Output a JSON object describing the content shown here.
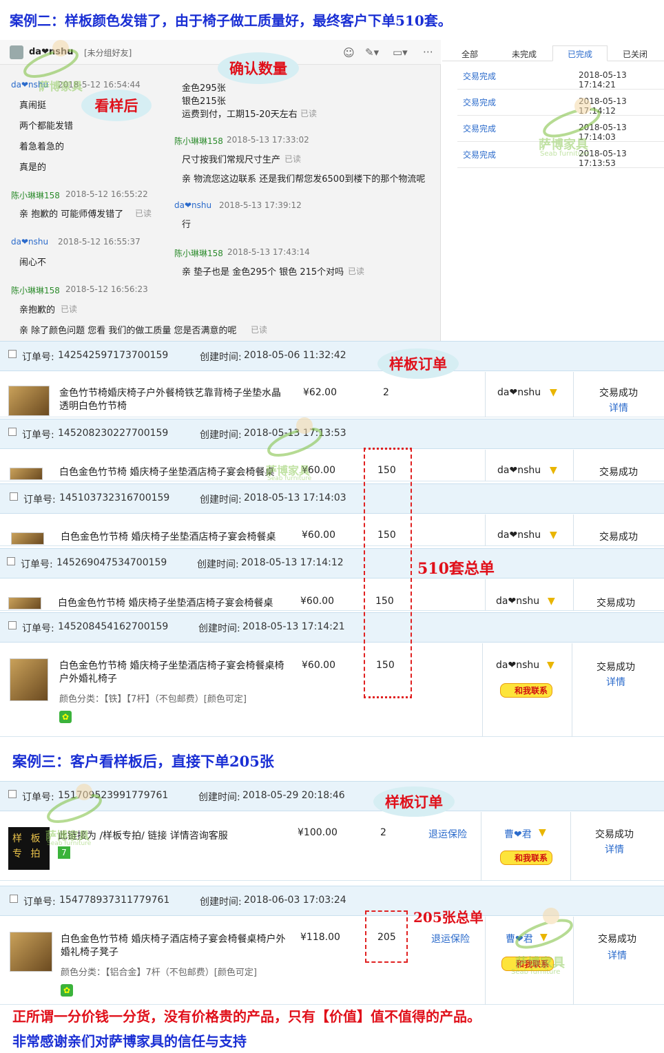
{
  "case2_title": "案例二：样板颜色发错了，由于椅子做工质量好，最终客户下单510套。",
  "chat": {
    "contact_name": "da❤nshu",
    "group_label": "[未分组好友]",
    "bubbles": {
      "confirm_qty": "确认数量",
      "after_sample": "看样后"
    },
    "messages": [
      {
        "sender": "da❤nshu",
        "time": "2018-5-12 16:54:44",
        "lines": [
          "真闹挺",
          "两个都能发错",
          "着急着急的",
          "真是的"
        ]
      },
      {
        "sender": "陈小琳琳158",
        "time": "2018-5-12 16:55:22",
        "lines": [
          "亲 抱歉的  可能师傅发错了"
        ],
        "read": "已读"
      },
      {
        "sender": "da❤nshu",
        "time": "2018-5-12 16:55:37",
        "lines": [
          "闹心不"
        ]
      },
      {
        "sender": "陈小琳琳158",
        "time": "2018-5-12 16:56:23",
        "lines": [
          "亲抱歉的",
          "亲 除了颜色问题 您看 我们的做工质量 您是否满意的呢"
        ],
        "read": "已读"
      },
      {
        "sender": "",
        "time": "",
        "lines": [
          "金色295张",
          "银色215张",
          "运费到付，工期15-20天左右"
        ],
        "read": "已读"
      },
      {
        "sender": "陈小琳琳158",
        "time": "2018-5-13 17:33:02",
        "lines": [
          "尺寸按我们常规尺寸生产",
          "亲 物流您这边联系 还是我们帮您发6500到楼下的那个物流呢"
        ],
        "read": "已读"
      },
      {
        "sender": "da❤nshu",
        "time": "2018-5-13 17:39:12",
        "lines": [
          "行"
        ]
      },
      {
        "sender": "陈小琳琳158",
        "time": "2018-5-13 17:43:14",
        "lines": [
          "亲 垫子也是 金色295个  银色 215个对吗"
        ],
        "read": "已读"
      }
    ]
  },
  "tabs": [
    "全部",
    "未完成",
    "已完成",
    "已关闭"
  ],
  "trade_rows": [
    {
      "status": "交易完成",
      "time": "2018-05-13 17:14:21"
    },
    {
      "status": "交易完成",
      "time": "2018-05-13 17:14:12"
    },
    {
      "status": "交易完成",
      "time": "2018-05-13 17:14:03"
    },
    {
      "status": "交易完成",
      "time": "2018-05-13 17:13:53"
    }
  ],
  "labels": {
    "order_no": "订单号:",
    "created": "创建时间:",
    "sample_order": "样板订单",
    "total_510": "510套总单",
    "total_205": "205张总单",
    "trade_success": "交易成功",
    "details": "详情",
    "contact_me": "和我联系",
    "return_insurance": "退运保险",
    "buyer": "da❤nshu",
    "buyer2": "曹❤君"
  },
  "orders": [
    {
      "no": "142542597173700159",
      "created": "2018-05-06 11:32:42",
      "title": "金色竹节椅婚庆椅子户外餐椅铁艺靠背椅子坐垫水晶透明白色竹节椅",
      "price": "¥62.00",
      "qty": "2"
    },
    {
      "no": "145208230227700159",
      "created": "2018-05-13 17:13:53",
      "title": "白色金色竹节椅 婚庆椅子坐垫酒店椅子宴会椅餐桌",
      "price": "¥60.00",
      "qty": "150"
    },
    {
      "no": "145103732316700159",
      "created": "2018-05-13 17:14:03",
      "title": "白色金色竹节椅 婚庆椅子坐垫酒店椅子宴会椅餐桌",
      "price": "¥60.00",
      "qty": "150"
    },
    {
      "no": "145269047534700159",
      "created": "2018-05-13 17:14:12",
      "title": "白色金色竹节椅 婚庆椅子坐垫酒店椅子宴会椅餐桌",
      "price": "¥60.00",
      "qty": "150"
    },
    {
      "no": "145208454162700159",
      "created": "2018-05-13 17:14:21",
      "title": "白色金色竹节椅 婚庆椅子坐垫酒店椅子宴会椅餐桌椅户外婚礼椅子",
      "price": "¥60.00",
      "qty": "150",
      "spec": "颜色分类：【铁】【7杆】（不包邮费）[颜色可定]"
    }
  ],
  "case3_title": "案例三：客户看样板后，直接下单205张",
  "orders3": [
    {
      "no": "151709523991779761",
      "created": "2018-05-29 20:18:46",
      "title": "此链接为 /样板专拍/ 链接 详情咨询客服",
      "price": "¥100.00",
      "qty": "2",
      "thumb_text": "样 板 专 拍"
    },
    {
      "no": "154778937311779761",
      "created": "2018-06-03 17:03:24",
      "title": "白色金色竹节椅 婚庆椅子酒店椅子宴会椅餐桌椅户外婚礼椅子凳子",
      "price": "¥118.00",
      "qty": "205",
      "spec": "颜色分类：【铝合金】7杆（不包邮费）[颜色可定]"
    }
  ],
  "footer": {
    "line1": "正所谓一分价钱一分货，没有价格贵的产品，只有【价值】值不值得的产品。",
    "line2": "非常感谢亲们对萨博家具的信任与支持"
  },
  "watermark": {
    "cn": "萨博家具",
    "en": "Seab furniture"
  },
  "colors": {
    "heading_blue": "#1a2fd4",
    "accent_red": "#e0101a",
    "link_blue": "#2a6acb",
    "order_header_bg": "#e8f3fa"
  }
}
